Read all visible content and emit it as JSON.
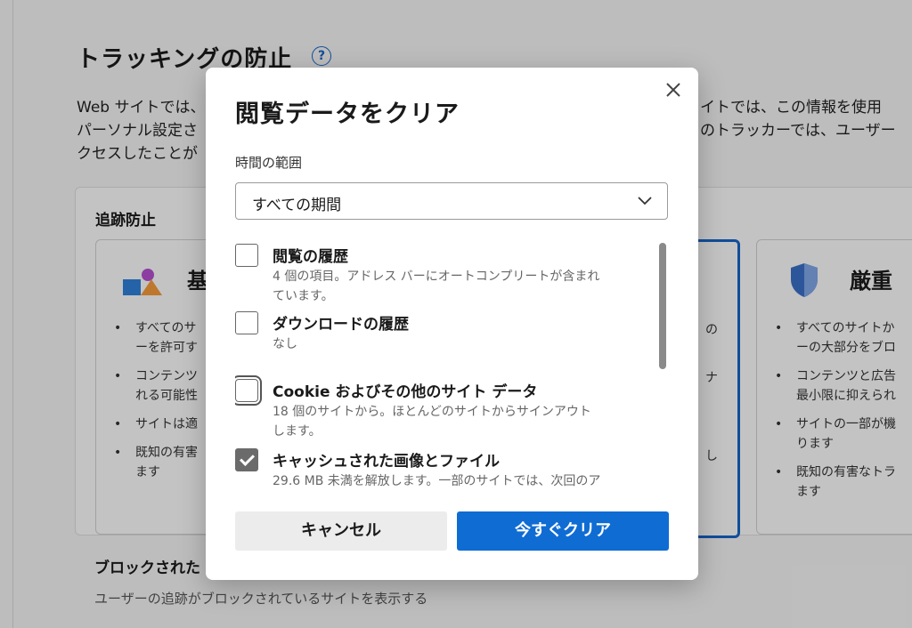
{
  "settings_page": {
    "title": "トラッキングの防止",
    "intro": {
      "line1_left": "Web サイトでは、",
      "line1_right": "イトでは、この情報を使用",
      "line2_left": "パーソナル設定さ",
      "line2_right": "のトラッカーでは、ユーザー",
      "line3_left": "クセスしたことが"
    },
    "tracking": {
      "section_title": "追跡防止",
      "basic": {
        "name": "基",
        "bullets": [
          [
            "すべてのサ",
            "ーを許可す"
          ],
          [
            "コンテンツ",
            "れる可能性"
          ],
          [
            "サイトは適"
          ],
          [
            "既知の有害",
            "ます"
          ]
        ]
      },
      "balanced": {
        "bullets": [
          [
            "の"
          ],
          [
            "ナ"
          ],
          [
            ""
          ],
          [
            "し"
          ]
        ]
      },
      "strict": {
        "name": "厳重",
        "bullets": [
          [
            "すべてのサイトか",
            "ーの大部分をブロ"
          ],
          [
            "コンテンツと広告",
            "最小限に抑えられ"
          ],
          [
            "サイトの一部が機",
            "ります"
          ],
          [
            "既知の有害なトラ",
            "ます"
          ]
        ]
      }
    },
    "blocked": {
      "title": "ブロックされた",
      "desc": "ユーザーの追跡がブロックされているサイトを表示する"
    }
  },
  "dialog": {
    "title": "閲覧データをクリア",
    "time_range_label": "時間の範囲",
    "time_range_value": "すべての期間",
    "items": [
      {
        "title": "閲覧の履歴",
        "desc": [
          "4 個の項目。アドレス バーにオートコンプリートが含まれ",
          "ています。"
        ],
        "checked": false
      },
      {
        "title": "ダウンロードの履歴",
        "desc": [
          "なし"
        ],
        "checked": false
      },
      {
        "title": "Cookie およびその他のサイト データ",
        "desc": [
          "18 個のサイトから。ほとんどのサイトからサインアウト",
          "します。"
        ],
        "checked": false
      },
      {
        "title": "キャッシュされた画像とファイル",
        "desc": [
          "29.6 MB 未満を解放します。一部のサイトでは、次回のア"
        ],
        "checked": true
      }
    ],
    "cancel_label": "キャンセル",
    "clear_label": "今すぐクリア"
  },
  "icons": {
    "help": "question-circle-icon",
    "close": "close-icon",
    "dropdown": "chevron-down-icon",
    "basic": "shapes-icon",
    "strict": "shield-icon"
  },
  "colors": {
    "accent": "#0f6cd3",
    "selected_border": "#1763c7"
  }
}
